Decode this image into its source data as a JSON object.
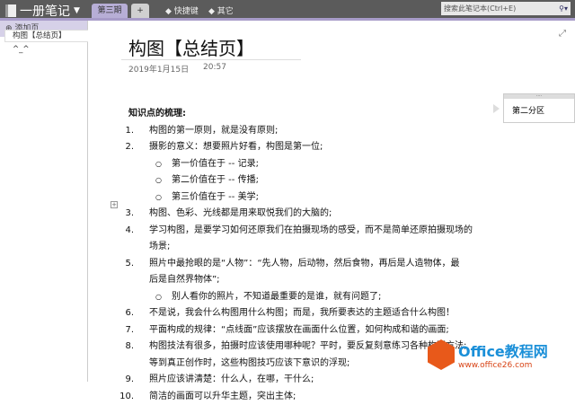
{
  "topbar": {
    "notebook": "一册笔记",
    "tabs": [
      "第三期",
      "+"
    ],
    "quick": [
      "快捷键",
      "其它"
    ],
    "search_placeholder": "搜索此笔记本(Ctrl+E)"
  },
  "sidebar": {
    "add_page": "添加页",
    "pages": [
      "构图【总结页】",
      "^_^"
    ]
  },
  "page": {
    "title": "构图【总结页】",
    "date": "2019年1月15日",
    "time": "20:57",
    "heading": "知识点的梳理:",
    "lines": [
      {
        "n": "1.",
        "t": "构图的第一原则，就是没有原则;"
      },
      {
        "n": "2.",
        "t": "摄影的意义：想要照片好看，构图是第一位;"
      },
      {
        "b": "第一价值在于 -- 记录;"
      },
      {
        "b": "第二价值在于 -- 传播;"
      },
      {
        "b": "第三价值在于 -- 美学;"
      },
      {
        "n": "3.",
        "t": "构图、色彩、光线都是用来取悦我们的大脑的;"
      },
      {
        "n": "4.",
        "t": "学习构图，是要学习如何还原我们在拍摄现场的感受，而不是简单还原拍摄现场的"
      },
      {
        "t": "场景;"
      },
      {
        "n": "5.",
        "t": "照片中最抢眼的是“人物”：“先人物，后动物，然后食物，再后是人造物体，最"
      },
      {
        "t": "后是自然界物体”;"
      },
      {
        "b": "别人看你的照片，不知道最重要的是谁，就有问题了;"
      },
      {
        "n": "6.",
        "t": "不是说，我会什么构图用什么构图；而是，我所要表达的主题适合什么构图！"
      },
      {
        "n": "7.",
        "t": "平面构成的规律：“点线面”应该摆放在画面什么位置，如何构成和谐的画面;"
      },
      {
        "n": "8.",
        "t": "构图技法有很多，拍摄时应该使用哪种呢？平时，要反复刻意练习各种构图方法;"
      },
      {
        "t": "等到真正创作时，这些构图技巧应该下意识的浮现;"
      },
      {
        "n": "9.",
        "t": "照片应该讲清楚：什么人，在哪，干什么;"
      },
      {
        "n": "10.",
        "t": "简洁的画面可以升华主题，突出主体;"
      }
    ]
  },
  "section_box": {
    "text": "第二分区"
  },
  "watermark": {
    "brand": "Office教程网",
    "url": "www.office26.com"
  }
}
